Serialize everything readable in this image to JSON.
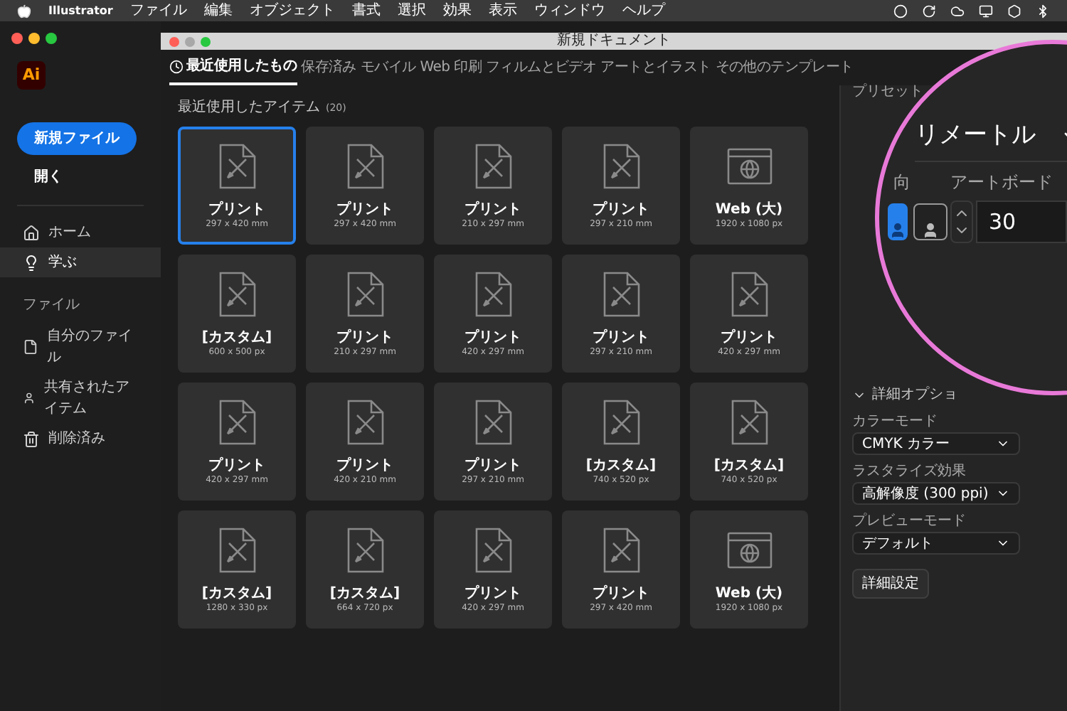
{
  "menu_bar": {
    "app": "Illustrator",
    "items": [
      "ファイル",
      "編集",
      "オブジェクト",
      "書式",
      "選択",
      "効果",
      "表示",
      "ウィンドウ",
      "ヘルプ"
    ]
  },
  "sidebar": {
    "logo": "Ai",
    "new_button": "新規ファイル",
    "open": "開く",
    "nav": [
      {
        "kind": "home",
        "label": "ホーム",
        "selected": false
      },
      {
        "kind": "learn",
        "label": "学ぶ",
        "selected": true
      }
    ],
    "section": "ファイル",
    "files": [
      {
        "kind": "file",
        "label": "自分のファイル"
      },
      {
        "kind": "shared",
        "label": "共有されたアイテム"
      },
      {
        "kind": "trash",
        "label": "削除済み"
      }
    ]
  },
  "dialog": {
    "title": "新規ドキュメント",
    "tabs": [
      {
        "label": "最近使用したもの",
        "selected": true
      },
      {
        "label": "保存済み",
        "selected": false
      },
      {
        "label": "モバイル",
        "selected": false
      },
      {
        "label": "Web",
        "selected": false
      },
      {
        "label": "印刷",
        "selected": false
      },
      {
        "label": "フィルムとビデオ",
        "selected": false
      },
      {
        "label": "アートとイラスト",
        "selected": false
      },
      {
        "label": "その他のテンプレート",
        "selected": false
      }
    ],
    "section_title": "最近使用したアイテム",
    "count": "(20)",
    "items": [
      {
        "kind": "print",
        "name": "プリント",
        "size": "297 x 420 mm",
        "selected": true
      },
      {
        "kind": "print",
        "name": "プリント",
        "size": "297 x 420 mm",
        "selected": false
      },
      {
        "kind": "print",
        "name": "プリント",
        "size": "210 x 297 mm",
        "selected": false
      },
      {
        "kind": "print",
        "name": "プリント",
        "size": "297 x 210 mm",
        "selected": false
      },
      {
        "kind": "web",
        "name": "Web (大)",
        "size": "1920 x 1080 px",
        "selected": false
      },
      {
        "kind": "print",
        "name": "[カスタム]",
        "size": "600 x 500 px",
        "selected": false
      },
      {
        "kind": "print",
        "name": "プリント",
        "size": "210 x 297 mm",
        "selected": false
      },
      {
        "kind": "print",
        "name": "プリント",
        "size": "420 x 297 mm",
        "selected": false
      },
      {
        "kind": "print",
        "name": "プリント",
        "size": "297 x 210 mm",
        "selected": false
      },
      {
        "kind": "print",
        "name": "プリント",
        "size": "420 x 297 mm",
        "selected": false
      },
      {
        "kind": "print",
        "name": "プリント",
        "size": "420 x 297 mm",
        "selected": false
      },
      {
        "kind": "print",
        "name": "プリント",
        "size": "420 x 210 mm",
        "selected": false
      },
      {
        "kind": "print",
        "name": "プリント",
        "size": "297 x 210 mm",
        "selected": false
      },
      {
        "kind": "print",
        "name": "[カスタム]",
        "size": "740 x 520 px",
        "selected": false
      },
      {
        "kind": "print",
        "name": "[カスタム]",
        "size": "740 x 520 px",
        "selected": false
      },
      {
        "kind": "print",
        "name": "[カスタム]",
        "size": "1280 x 330 px",
        "selected": false
      },
      {
        "kind": "print",
        "name": "[カスタム]",
        "size": "664 x 720 px",
        "selected": false
      },
      {
        "kind": "print",
        "name": "プリント",
        "size": "420 x 297 mm",
        "selected": false
      },
      {
        "kind": "print",
        "name": "プリント",
        "size": "297 x 420 mm",
        "selected": false
      },
      {
        "kind": "web",
        "name": "Web (大)",
        "size": "1920 x 1080 px",
        "selected": false
      }
    ]
  },
  "panel": {
    "preset_label": "プリセット",
    "advanced_toggle": "詳細オプショ",
    "dropdowns": [
      {
        "label": "カラーモード",
        "value": "CMYK カラー"
      },
      {
        "label": "ラスタライズ効果",
        "value": "高解像度 (300 ppi)"
      },
      {
        "label": "プレビューモード",
        "value": "デフォルト"
      }
    ],
    "button": "詳細設定",
    "magnifier": {
      "preset_value": "リメートル",
      "orientation_label": "向",
      "artboard_label": "アートボード",
      "artboard_value": "30",
      "orientations": [
        {
          "kind": "portrait",
          "selected": true
        },
        {
          "kind": "landscape",
          "selected": false
        }
      ]
    }
  }
}
